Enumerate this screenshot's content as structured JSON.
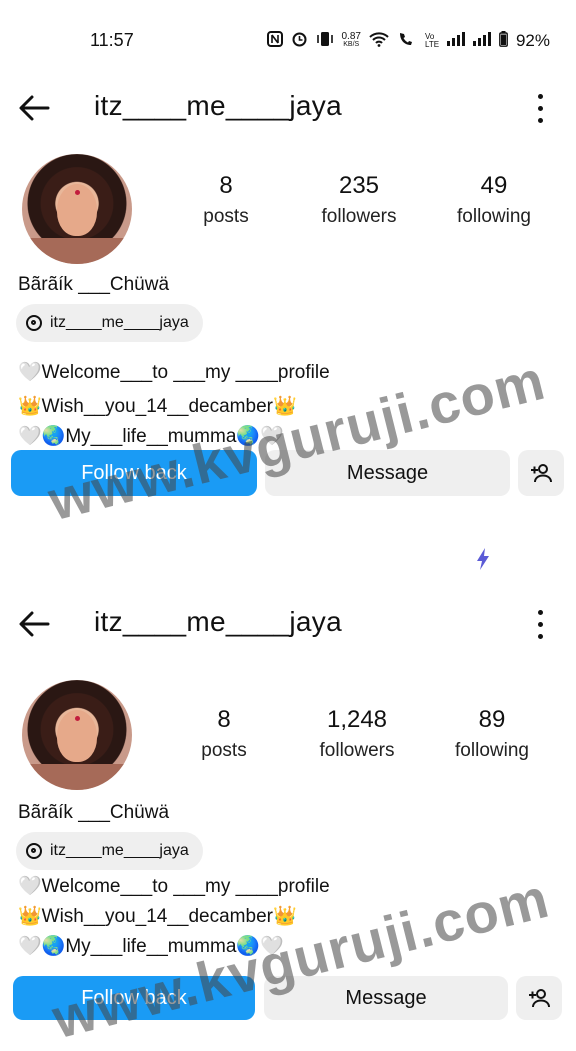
{
  "status_bar": {
    "time": "11:57",
    "net_speed_value": "0.87",
    "net_speed_unit": "KB/S",
    "volte": "Vo LTE",
    "battery": "92%"
  },
  "profiles": [
    {
      "username": "itz____me____jaya",
      "posts_count": "8",
      "posts_label": "posts",
      "followers_count": "235",
      "followers_label": "followers",
      "following_count": "49",
      "following_label": "following",
      "display_name": "Bãrãík ___Chüwä",
      "threads_handle": "itz____me____jaya",
      "bio": [
        "🤍Welcome___to ___my ____profile",
        "👑Wish__you_14__decamber👑",
        "🤍🌏My___life__mumma🌏🤍"
      ],
      "follow_back_label": "Follow back",
      "message_label": "Message"
    },
    {
      "username": "itz____me____jaya",
      "posts_count": "8",
      "posts_label": "posts",
      "followers_count": "1,248",
      "followers_label": "followers",
      "following_count": "89",
      "following_label": "following",
      "display_name": "Bãrãík ___Chüwä",
      "threads_handle": "itz____me____jaya",
      "bio": [
        "🤍Welcome___to ___my ____profile",
        "👑Wish__you_14__decamber👑",
        "🤍🌏My___life__mumma🌏🤍"
      ],
      "follow_back_label": "Follow back",
      "message_label": "Message"
    }
  ],
  "watermark": "www.kvguruji.com",
  "colors": {
    "follow_button": "#1a9bf5",
    "secondary_button": "#efefef",
    "bolt_icon": "#5b5bd6"
  }
}
